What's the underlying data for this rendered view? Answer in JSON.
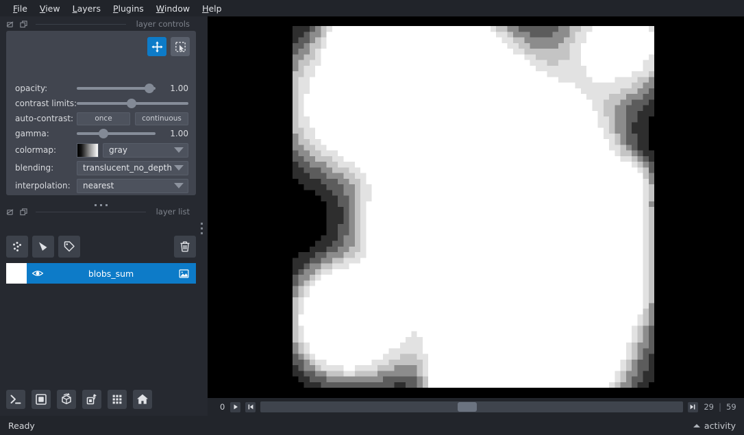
{
  "menubar": {
    "items": [
      {
        "label": "File",
        "accel": "F"
      },
      {
        "label": "View",
        "accel": "V"
      },
      {
        "label": "Layers",
        "accel": "L"
      },
      {
        "label": "Plugins",
        "accel": "P"
      },
      {
        "label": "Window",
        "accel": "W"
      },
      {
        "label": "Help",
        "accel": "H"
      }
    ]
  },
  "layer_controls": {
    "dock_title": "layer controls",
    "modes": [
      {
        "name": "pan-zoom",
        "active": true
      },
      {
        "name": "transform",
        "active": false
      }
    ],
    "rows": {
      "opacity": {
        "label": "opacity:",
        "value": "1.00",
        "position_pct": 92
      },
      "contrast_limits": {
        "label": "contrast limits:",
        "position_pct": 49
      },
      "auto_contrast": {
        "label": "auto-contrast:",
        "once": "once",
        "continuous": "continuous"
      },
      "gamma": {
        "label": "gamma:",
        "value": "1.00",
        "position_pct": 34
      },
      "colormap": {
        "label": "colormap:",
        "value": "gray"
      },
      "blending": {
        "label": "blending:",
        "value": "translucent_no_depth"
      },
      "interpolation": {
        "label": "interpolation:",
        "value": "nearest"
      }
    }
  },
  "layer_list": {
    "dock_title": "layer list",
    "buttons": [
      {
        "name": "new-points",
        "tooltip": "New points layer"
      },
      {
        "name": "new-shapes",
        "tooltip": "New shapes layer"
      },
      {
        "name": "new-labels",
        "tooltip": "New labels layer"
      },
      {
        "name": "delete-layer",
        "tooltip": "Delete selected layer"
      }
    ],
    "layers": [
      {
        "name": "blobs_sum",
        "visible": true,
        "selected": true,
        "type": "image"
      }
    ]
  },
  "viewer_buttons": [
    {
      "name": "console",
      "tooltip": "Open IPython console"
    },
    {
      "name": "ndisplay-toggle",
      "tooltip": "Toggle 2D/3D view"
    },
    {
      "name": "roll-dims",
      "tooltip": "Roll dimensions order"
    },
    {
      "name": "transpose-dims",
      "tooltip": "Transpose displayed dimensions"
    },
    {
      "name": "grid-view",
      "tooltip": "Toggle grid view"
    },
    {
      "name": "home",
      "tooltip": "Reset view"
    }
  ],
  "dims": {
    "axis_label": "0",
    "current": "29",
    "separator": "|",
    "max": "59",
    "position_pct": 49
  },
  "statusbar": {
    "status": "Ready",
    "activity": "activity"
  },
  "colors": {
    "accent": "#0d7bc8",
    "panel": "#41454f",
    "dock": "#262930",
    "window": "#22252b",
    "canvas": "#000000",
    "text": "#d4d6da",
    "muted": "#7e838c"
  }
}
